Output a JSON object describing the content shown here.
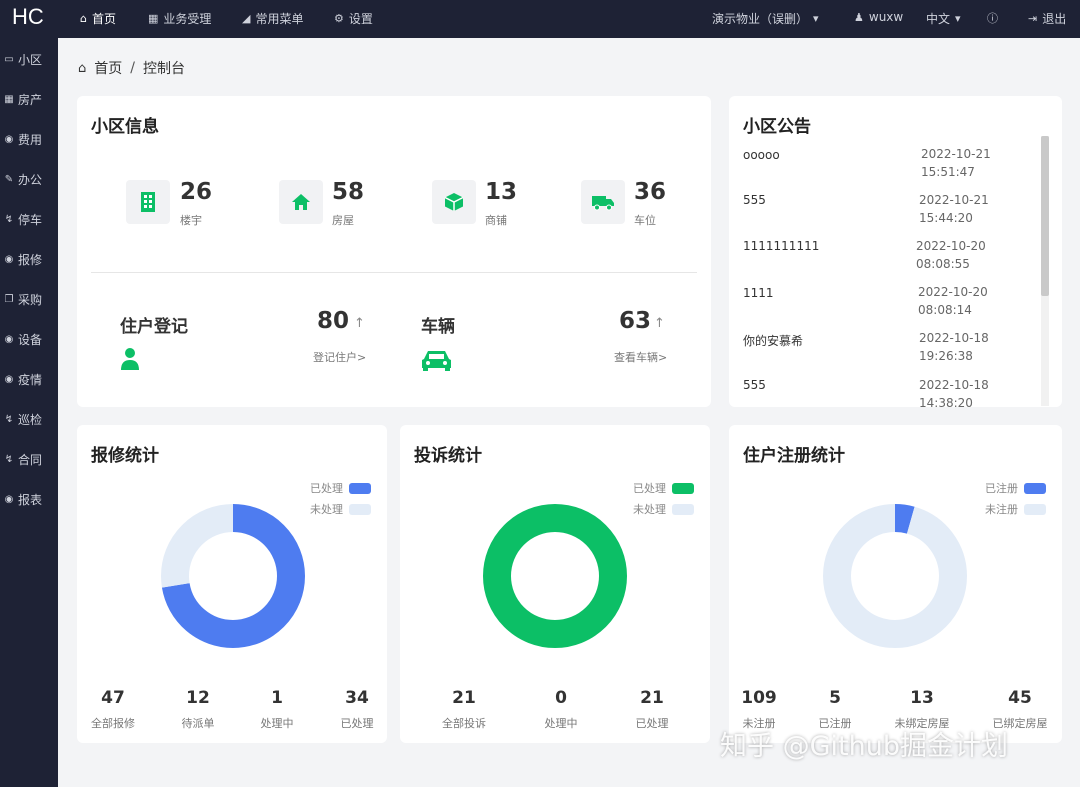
{
  "brand": "HC",
  "topnav": {
    "items": [
      {
        "label": "首页",
        "icon": "home-icon"
      },
      {
        "label": "业务受理",
        "icon": "table-icon"
      },
      {
        "label": "常用菜单",
        "icon": "sitemap-icon"
      },
      {
        "label": "设置",
        "icon": "gear-icon"
      }
    ],
    "community": "演示物业（误删）",
    "user": "wuxw",
    "language": "中文",
    "logout": "退出"
  },
  "sidebar": {
    "items": [
      "小区",
      "房产",
      "费用",
      "办公",
      "停车",
      "报修",
      "采购",
      "设备",
      "疫情",
      "巡检",
      "合同",
      "报表"
    ]
  },
  "breadcrumb": {
    "home": "首页",
    "separator": "/",
    "current": "控制台"
  },
  "community_info": {
    "title": "小区信息",
    "stats": [
      {
        "value": "26",
        "label": "楼宇"
      },
      {
        "value": "58",
        "label": "房屋"
      },
      {
        "value": "13",
        "label": "商铺"
      },
      {
        "value": "36",
        "label": "车位"
      }
    ],
    "owner": {
      "title": "住户登记",
      "value": "80",
      "link": "登记住户>"
    },
    "vehicle": {
      "title": "车辆",
      "value": "63",
      "link": "查看车辆>"
    }
  },
  "notices": {
    "title": "小区公告",
    "items": [
      {
        "title": "ooooo",
        "date": "2022-10-21",
        "time": "15:51:47"
      },
      {
        "title": "555",
        "date": "2022-10-21",
        "time": "15:44:20"
      },
      {
        "title": "1111111111",
        "date": "2022-10-20",
        "time": "08:08:55"
      },
      {
        "title": "1111",
        "date": "2022-10-20",
        "time": "08:08:14"
      },
      {
        "title": "你的安慕希",
        "date": "2022-10-18",
        "time": "19:26:38"
      },
      {
        "title": "555",
        "date": "2022-10-18",
        "time": "14:38:20"
      }
    ]
  },
  "repair": {
    "title": "报修统计",
    "legend": [
      "已处理",
      "未处理"
    ],
    "colors": [
      "#4e7cf0",
      "#e3ecf7"
    ],
    "stats": [
      {
        "value": "47",
        "label": "全部报修"
      },
      {
        "value": "12",
        "label": "待派单"
      },
      {
        "value": "1",
        "label": "处理中"
      },
      {
        "value": "34",
        "label": "已处理"
      }
    ]
  },
  "complaint": {
    "title": "投诉统计",
    "legend": [
      "已处理",
      "未处理"
    ],
    "colors": [
      "#0cbf66",
      "#e3ecf7"
    ],
    "stats": [
      {
        "value": "21",
        "label": "全部投诉"
      },
      {
        "value": "0",
        "label": "处理中"
      },
      {
        "value": "21",
        "label": "已处理"
      }
    ]
  },
  "register": {
    "title": "住户注册统计",
    "legend": [
      "已注册",
      "未注册"
    ],
    "colors": [
      "#4e7cf0",
      "#e3ecf7"
    ],
    "stats": [
      {
        "value": "109",
        "label": "未注册"
      },
      {
        "value": "5",
        "label": "已注册"
      },
      {
        "value": "13",
        "label": "未绑定房屋"
      },
      {
        "value": "45",
        "label": "已绑定房屋"
      }
    ]
  },
  "chart_data": [
    {
      "type": "pie",
      "categories": [
        "已处理",
        "未处理"
      ],
      "values": [
        34,
        13
      ]
    },
    {
      "type": "pie",
      "categories": [
        "已处理",
        "未处理"
      ],
      "values": [
        21,
        0
      ]
    },
    {
      "type": "pie",
      "categories": [
        "已注册",
        "未注册"
      ],
      "values": [
        5,
        109
      ]
    }
  ],
  "watermark": "知乎 @Github掘金计划"
}
